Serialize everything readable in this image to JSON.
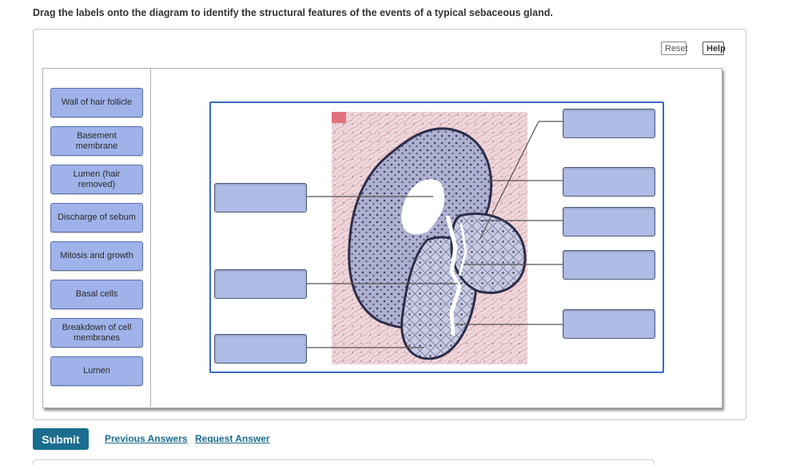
{
  "instruction": "Drag the labels onto the diagram to identify the structural features of the events of a typical sebaceous gland.",
  "toolbar": {
    "reset_label": "Reset",
    "help_label": "Help"
  },
  "labels": [
    "Wall of hair follicle",
    "Basement\nmembrane",
    "Lumen (hair\nremoved)",
    "Discharge of sebum",
    "Mitosis and growth",
    "Basal cells",
    "Breakdown of cell\nmembranes",
    "Lumen"
  ],
  "footer": {
    "submit_label": "Submit",
    "previous_answers_label": "Previous Answers",
    "request_answer_label": "Request Answer"
  }
}
